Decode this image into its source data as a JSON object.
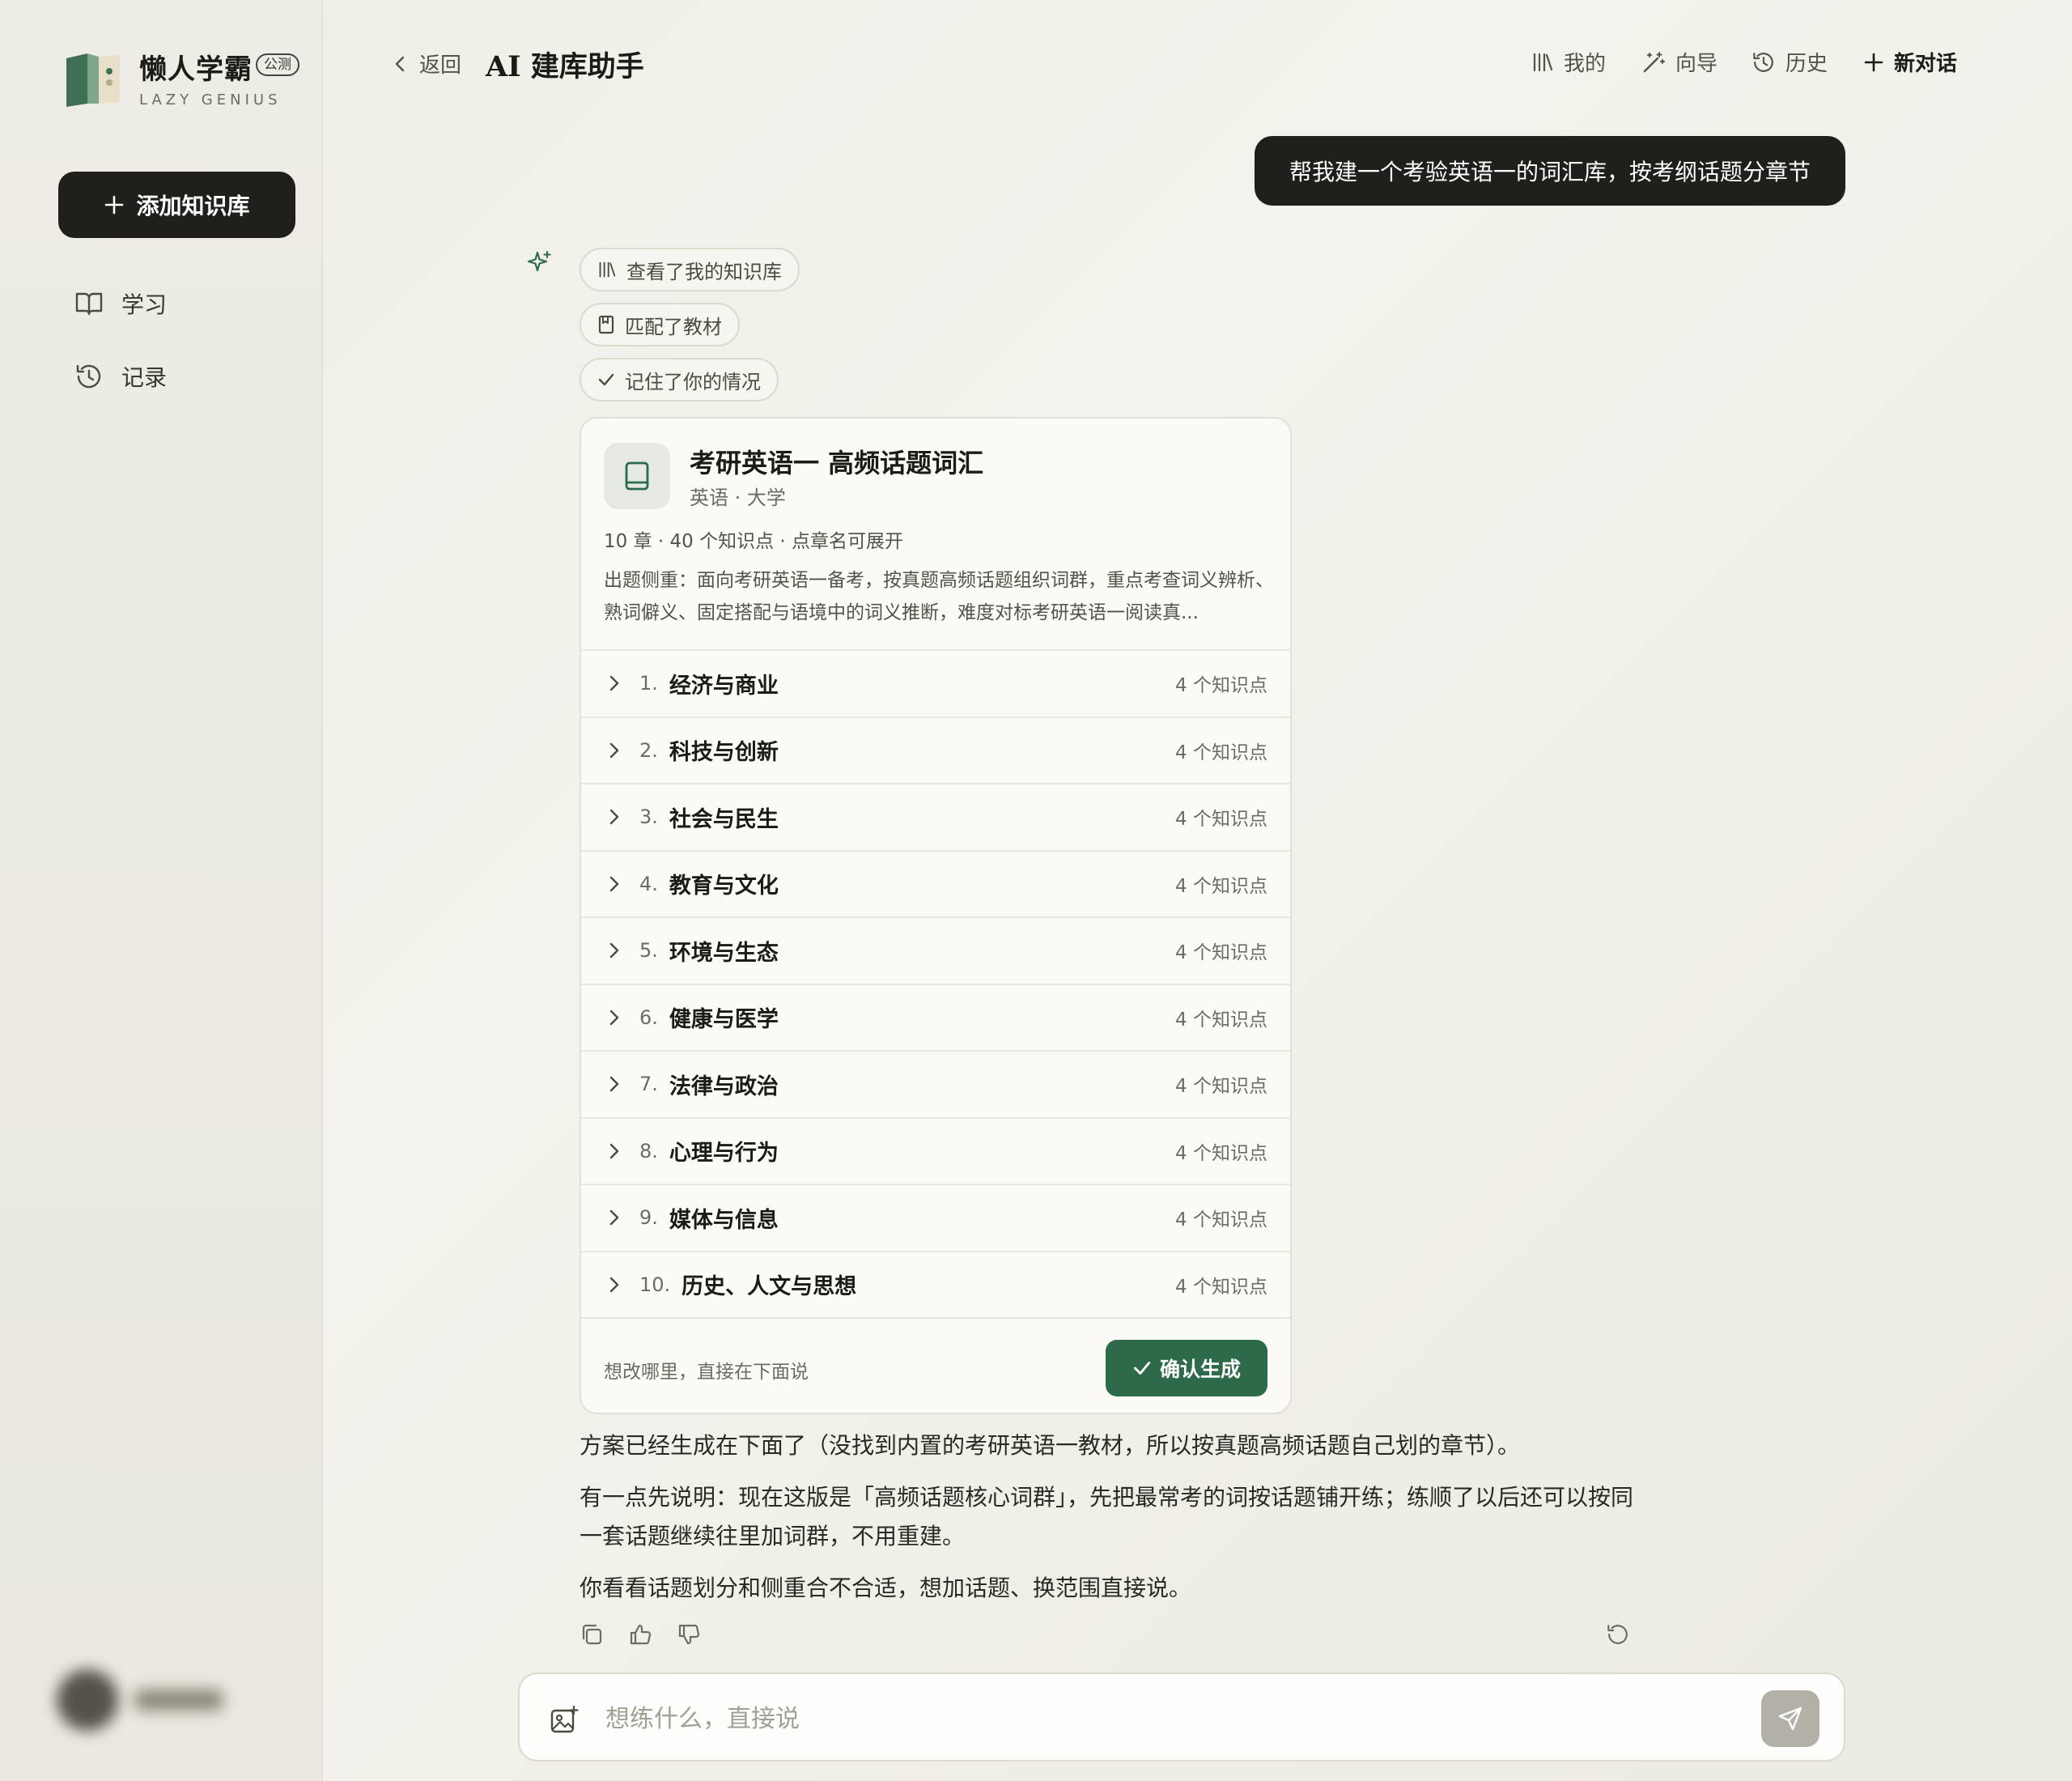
{
  "brand": {
    "name": "懒人学霸",
    "badge": "公测",
    "subtitle": "LAZY GENIUS"
  },
  "sidebar": {
    "add_button": "添加知识库",
    "items": [
      {
        "label": "学习",
        "icon": "book-open-icon"
      },
      {
        "label": "记录",
        "icon": "history-icon"
      }
    ]
  },
  "header": {
    "back_label": "返回",
    "title": "AI 建库助手",
    "nav": [
      {
        "label": "我的",
        "icon": "library-icon"
      },
      {
        "label": "向导",
        "icon": "magic-wand-icon"
      },
      {
        "label": "历史",
        "icon": "history-icon"
      },
      {
        "label": "新对话",
        "icon": "plus-icon"
      }
    ]
  },
  "chat": {
    "user_message": "帮我建一个考验英语一的词汇库，按考纲话题分章节",
    "steps": [
      "查看了我的知识库",
      "匹配了教材",
      "记住了你的情况"
    ],
    "card": {
      "title": "考研英语一 高频话题词汇",
      "subtitle": "英语 · 大学",
      "meta": "10 章 · 40 个知识点 · 点章名可展开",
      "description": "出题侧重：面向考研英语一备考，按真题高频话题组织词群，重点考查词义辨析、熟词僻义、固定搭配与语境中的词义推断，难度对标考研英语一阅读真...",
      "chapters": [
        {
          "num": "1.",
          "name": "经济与商业",
          "count": "4 个知识点"
        },
        {
          "num": "2.",
          "name": "科技与创新",
          "count": "4 个知识点"
        },
        {
          "num": "3.",
          "name": "社会与民生",
          "count": "4 个知识点"
        },
        {
          "num": "4.",
          "name": "教育与文化",
          "count": "4 个知识点"
        },
        {
          "num": "5.",
          "name": "环境与生态",
          "count": "4 个知识点"
        },
        {
          "num": "6.",
          "name": "健康与医学",
          "count": "4 个知识点"
        },
        {
          "num": "7.",
          "name": "法律与政治",
          "count": "4 个知识点"
        },
        {
          "num": "8.",
          "name": "心理与行为",
          "count": "4 个知识点"
        },
        {
          "num": "9.",
          "name": "媒体与信息",
          "count": "4 个知识点"
        },
        {
          "num": "10.",
          "name": "历史、人文与思想",
          "count": "4 个知识点"
        }
      ],
      "footer_hint": "想改哪里，直接在下面说",
      "confirm_label": "确认生成"
    },
    "reply": [
      "方案已经生成在下面了（没找到内置的考研英语一教材，所以按真题高频话题自己划的章节）。",
      "有一点先说明：现在这版是「高频话题核心词群」，先把最常考的词按话题铺开练；练顺了以后还可以按同一套话题继续往里加词群，不用重建。",
      "你看看话题划分和侧重合不合适，想加话题、换范围直接说。"
    ]
  },
  "input": {
    "placeholder": "想练什么，直接说"
  },
  "colors": {
    "accent": "#2d6a4a",
    "dark": "#201f1b",
    "background": "#efeee6"
  }
}
